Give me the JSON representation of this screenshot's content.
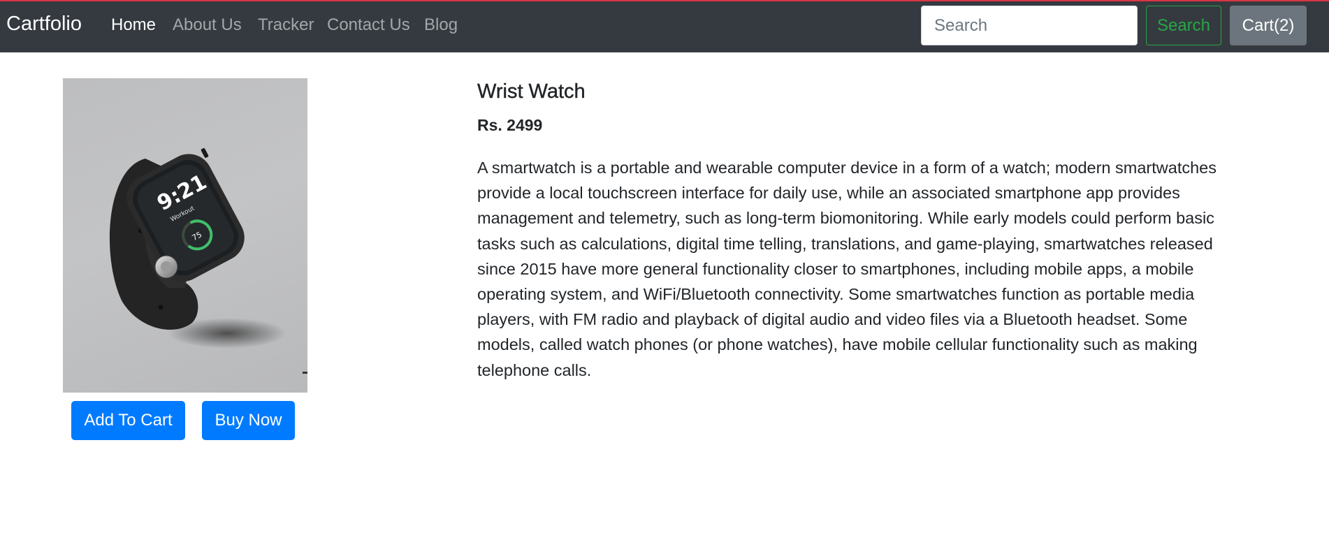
{
  "navbar": {
    "brand": "Cartfolio",
    "links": [
      {
        "label": "Home",
        "active": true
      },
      {
        "label": "About Us",
        "active": false
      },
      {
        "label": "Tracker",
        "active": false
      },
      {
        "label": "Contact Us",
        "active": false
      },
      {
        "label": "Blog",
        "active": false
      }
    ],
    "search": {
      "placeholder": "Search",
      "value": "",
      "button_label": "Search"
    },
    "cart_label": "Cart(2)"
  },
  "product": {
    "image_icon": "smartwatch-image",
    "watch_time": "9:21",
    "watch_sub": "Workout",
    "watch_ring_value": "75",
    "title": "Wrist Watch",
    "price": "Rs. 2499",
    "description": "A smartwatch is a portable and wearable computer device in a form of a watch; modern smartwatches provide a local touchscreen interface for daily use, while an associated smartphone app provides management and telemetry, such as long-term biomonitoring. While early models could perform basic tasks such as calculations, digital time telling, translations, and game-playing, smartwatches released since 2015 have more general functionality closer to smartphones, including mobile apps, a mobile operating system, and WiFi/Bluetooth connectivity. Some smartwatches function as portable media players, with FM radio and playback of digital audio and video files via a Bluetooth headset. Some models, called watch phones (or phone watches), have mobile cellular functionality such as making telephone calls.",
    "add_to_cart_label": "Add To Cart",
    "buy_now_label": "Buy Now"
  },
  "colors": {
    "navbar_bg": "#343a40",
    "navbar_top_border": "#dc3545",
    "primary": "#007bff",
    "success": "#28a745",
    "secondary": "#6c757d"
  }
}
